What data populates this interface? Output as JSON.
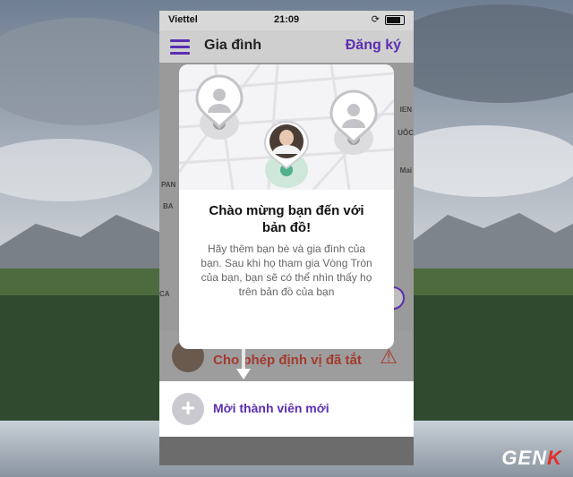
{
  "status_bar": {
    "carrier": "Viettel",
    "time": "21:09"
  },
  "nav": {
    "title": "Gia đình",
    "signup": "Đăng ký"
  },
  "map_labels": [
    "PAN",
    "BA",
    "CA"
  ],
  "map_labels_right": [
    "IEN",
    "UÔC",
    "Mai"
  ],
  "modal": {
    "headline": "Chào mừng bạn đến với bản đồ!",
    "body": "Hãy thêm bạn bè và gia đình của bạn. Sau khi họ tham gia Vòng Tròn của bạn, bạn sẽ có thể nhìn thấy họ trên bản đồ của bạn"
  },
  "banner": {
    "text": "Cho phép định vị đã tắt"
  },
  "invite": {
    "label": "Mời thành viên mới"
  },
  "watermark": {
    "prefix": "GEN",
    "suffix": "K"
  },
  "colors": {
    "accent": "#5b2eb0",
    "warning": "#a33a2e",
    "pin_green": "#4fb08a"
  }
}
